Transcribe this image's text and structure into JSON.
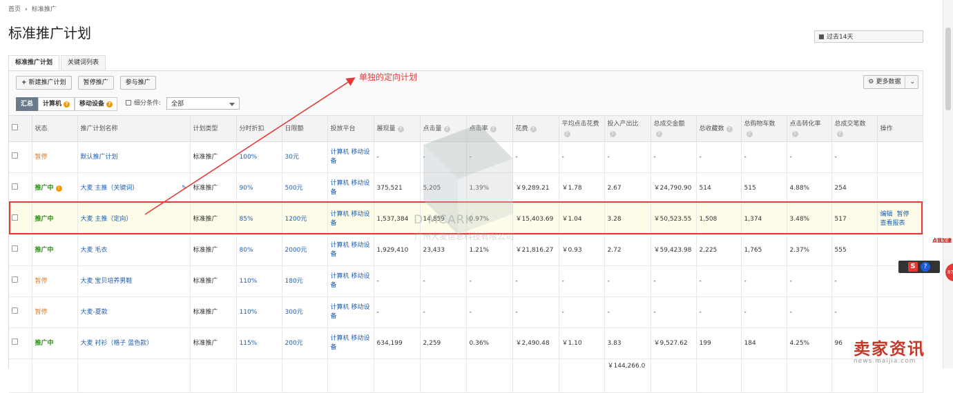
{
  "breadcrumb": {
    "home": "首页",
    "current": "标准推广"
  },
  "page_title": "标准推广计划",
  "date_range": "过去14天",
  "tabs": [
    {
      "label": "标准推广计划"
    },
    {
      "label": "关键词列表"
    }
  ],
  "toolbar": {
    "new_plan": "新建推广计划",
    "pause": "暂停推广",
    "join": "参与推广",
    "more_data": "更多数据"
  },
  "filters": {
    "summary": "汇总",
    "computer": "计算机",
    "mobile": "移动设备",
    "condition_label": "细分条件:",
    "condition_value": "全部"
  },
  "annotation": "单独的定向计划",
  "columns": [
    "状态",
    "推广计划名称",
    "计划类型",
    "分时折扣",
    "日限额",
    "投放平台",
    "展现量",
    "点击量",
    "点击率",
    "花费",
    "平均点击花费",
    "投入产出比",
    "总成交金额",
    "总收藏数",
    "总购物车数",
    "点击转化率",
    "总成交笔数",
    "操作"
  ],
  "rows": [
    {
      "status": "暂停",
      "name": "默认推广计划",
      "type": "标准推广",
      "discount": "100%",
      "limit": "30元",
      "platform": "计算机 移动设备",
      "impressions": "-",
      "clicks": "-",
      "ctr": "-",
      "cost": "-",
      "cpc": "-",
      "roi": "-",
      "gmv": "-",
      "favs": "-",
      "carts": "-",
      "cvr": "-",
      "orders": "-",
      "ops": []
    },
    {
      "status": "推广中",
      "name": "大麦 主推（关键词）",
      "type": "标准推广",
      "discount": "90%",
      "limit": "500元",
      "platform": "计算机 移动设备",
      "impressions": "375,521",
      "clicks": "5,205",
      "ctr": "1.39%",
      "cost": "￥9,289.21",
      "cpc": "￥1.78",
      "roi": "2.67",
      "gmv": "￥24,790.90",
      "favs": "514",
      "carts": "515",
      "cvr": "4.88%",
      "orders": "254",
      "ops": []
    },
    {
      "status": "推广中",
      "name": "大麦 主推（定向）",
      "type": "标准推广",
      "discount": "85%",
      "limit": "1200元",
      "platform": "计算机 移动设备",
      "impressions": "1,537,384",
      "clicks": "14,859",
      "ctr": "0.97%",
      "cost": "￥15,403.69",
      "cpc": "￥1.04",
      "roi": "3.28",
      "gmv": "￥50,523.55",
      "favs": "1,508",
      "carts": "1,374",
      "cvr": "3.48%",
      "orders": "517",
      "ops": [
        "编辑",
        "暂停",
        "查看报表"
      ]
    },
    {
      "status": "推广中",
      "name": "大麦 毛衣",
      "type": "标准推广",
      "discount": "80%",
      "limit": "2000元",
      "platform": "计算机 移动设备",
      "impressions": "1,929,410",
      "clicks": "23,433",
      "ctr": "1.21%",
      "cost": "￥21,816.27",
      "cpc": "￥0.93",
      "roi": "2.72",
      "gmv": "￥59,423.98",
      "favs": "2,225",
      "carts": "1,765",
      "cvr": "2.37%",
      "orders": "555",
      "ops": []
    },
    {
      "status": "暂停",
      "name": "大麦 宝贝培养男鞋",
      "type": "标准推广",
      "discount": "110%",
      "limit": "180元",
      "platform": "计算机 移动设备",
      "impressions": "-",
      "clicks": "-",
      "ctr": "-",
      "cost": "-",
      "cpc": "-",
      "roi": "-",
      "gmv": "-",
      "favs": "-",
      "carts": "-",
      "cvr": "-",
      "orders": "-",
      "ops": []
    },
    {
      "status": "暂停",
      "name": "大麦-夏款",
      "type": "标准推广",
      "discount": "110%",
      "limit": "300元",
      "platform": "计算机 移动设备",
      "impressions": "-",
      "clicks": "-",
      "ctr": "-",
      "cost": "-",
      "cpc": "-",
      "roi": "-",
      "gmv": "-",
      "favs": "-",
      "carts": "-",
      "cvr": "-",
      "orders": "-",
      "ops": []
    },
    {
      "status": "推广中",
      "name": "大麦 衬衫（格子 蓝色款）",
      "type": "标准推广",
      "discount": "115%",
      "limit": "200元",
      "platform": "计算机 移动设备",
      "impressions": "634,199",
      "clicks": "2,259",
      "ctr": "0.36%",
      "cost": "￥2,490.48",
      "cpc": "￥1.10",
      "roi": "3.83",
      "gmv": "￥9,527.62",
      "favs": "199",
      "carts": "184",
      "cvr": "4.25%",
      "orders": "96",
      "ops": []
    }
  ],
  "partial_row": {
    "gmv": "￥144,266.0"
  },
  "watermark": {
    "brand": "D·MCARK",
    "sub": "广州大麦信息科技有限公司"
  },
  "side_widget": {
    "tag": "点我加速",
    "value": "87"
  },
  "corner_logo": {
    "title": "卖家资讯",
    "url": "news.maijia.com"
  },
  "colors": {
    "status_active": "#2e8b1a",
    "status_paused": "#e77c1a",
    "link": "#1f5fb0",
    "annotation": "#e53935"
  }
}
